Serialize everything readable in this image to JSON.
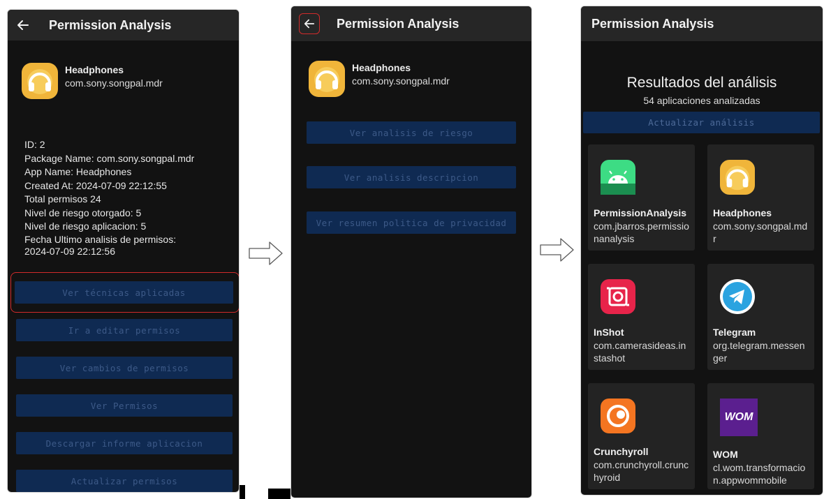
{
  "screen1": {
    "title": "Permission Analysis",
    "app": {
      "name": "Headphones",
      "package": "com.sony.songpal.mdr"
    },
    "details": [
      "ID: 2",
      "Package Name: com.sony.songpal.mdr",
      "App Name: Headphones",
      "Created At: 2024-07-09 22:12:55",
      "Total permisos 24",
      "Nivel de riesgo otorgado: 5",
      "Nivel de riesgo aplicacion: 5",
      "Fecha Ultimo analisis de permisos:\n2024-07-09 22:12:56"
    ],
    "buttons": [
      "Ver técnicas aplicadas",
      "Ir a editar permisos",
      "Ver cambios de permisos",
      "Ver Permisos",
      "Descargar informe aplicacion",
      "Actualizar permisos"
    ]
  },
  "screen2": {
    "title": "Permission Analysis",
    "app": {
      "name": "Headphones",
      "package": "com.sony.songpal.mdr"
    },
    "buttons": [
      "Ver analisis de riesgo",
      "Ver analisis descripcion",
      "Ver resumen politica de privacidad"
    ]
  },
  "screen3": {
    "title": "Permission Analysis",
    "results_title": "Resultados del análisis",
    "results_subtitle": "54 aplicaciones analizadas",
    "update_button": "Actualizar análisis",
    "apps": [
      {
        "name": "PermissionAnalysis",
        "package": "com.jbarros.permissionanalysis",
        "icon": "android-icon"
      },
      {
        "name": "Headphones",
        "package": "com.sony.songpal.mdr",
        "icon": "headphones-icon"
      },
      {
        "name": "InShot",
        "package": "com.camerasideas.instashot",
        "icon": "inshot-icon"
      },
      {
        "name": "Telegram",
        "package": "org.telegram.messenger",
        "icon": "telegram-icon"
      },
      {
        "name": "Crunchyroll",
        "package": "com.crunchyroll.crunchyroid",
        "icon": "crunchyroll-icon"
      },
      {
        "name": "WOM",
        "package": "cl.wom.transformacion.appwommobile",
        "icon": "wom-icon"
      }
    ],
    "wom_logo_text": "WOM"
  },
  "colors": {
    "accent_button": "#0f2a52",
    "button_text": "#3d5a88",
    "highlight": "#d12b2b",
    "appbar": "#262626",
    "background": "#121212"
  }
}
